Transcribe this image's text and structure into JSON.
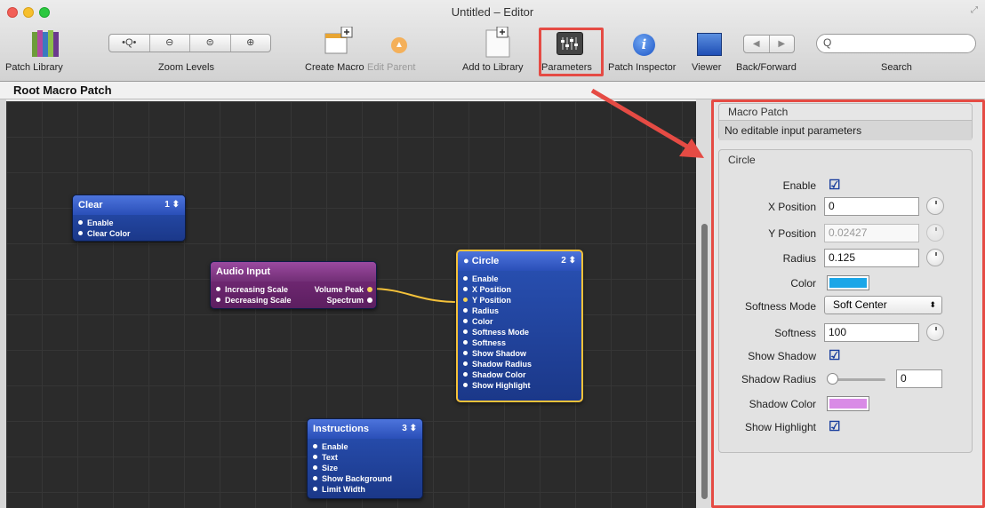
{
  "window": {
    "title": "Untitled – Editor"
  },
  "toolbar": {
    "patch_library": "Patch Library",
    "zoom_levels": "Zoom Levels",
    "create_macro": "Create Macro",
    "edit_parent": "Edit Parent",
    "add_to_library": "Add to Library",
    "parameters": "Parameters",
    "patch_inspector": "Patch Inspector",
    "viewer": "Viewer",
    "back_forward": "Back/Forward",
    "search": "Search",
    "search_placeholder": ""
  },
  "breadcrumb": "Root Macro Patch",
  "nodes": {
    "clear": {
      "title": "Clear",
      "badge": "1 ⬍",
      "ports": [
        "Enable",
        "Clear Color"
      ]
    },
    "audio": {
      "title": "Audio Input",
      "inputs": [
        "Increasing Scale",
        "Decreasing Scale"
      ],
      "outputs": [
        "Volume Peak",
        "Spectrum"
      ]
    },
    "circle": {
      "title": "Circle",
      "badge": "2 ⬍",
      "ports": [
        "Enable",
        "X Position",
        "Y Position",
        "Radius",
        "Color",
        "Softness Mode",
        "Softness",
        "Show Shadow",
        "Shadow Radius",
        "Shadow Color",
        "Show Highlight"
      ]
    },
    "instructions": {
      "title": "Instructions",
      "badge": "3 ⬍",
      "ports": [
        "Enable",
        "Text",
        "Size",
        "Show Background",
        "Limit Width"
      ]
    }
  },
  "panel": {
    "macro_header": "Macro Patch",
    "macro_message": "No editable input parameters",
    "circle_header": "Circle",
    "enable_label": "Enable",
    "x_label": "X Position",
    "x_value": "0",
    "y_label": "Y Position",
    "y_value": "0.02427",
    "radius_label": "Radius",
    "radius_value": "0.125",
    "color_label": "Color",
    "color_value": "#1aa6e8",
    "softness_mode_label": "Softness Mode",
    "softness_mode_value": "Soft Center",
    "softness_label": "Softness",
    "softness_value": "100",
    "show_shadow_label": "Show Shadow",
    "shadow_radius_label": "Shadow Radius",
    "shadow_radius_value": "0",
    "shadow_radius_level": 0,
    "shadow_color_label": "Shadow Color",
    "shadow_color_value": "#d98be6",
    "show_highlight_label": "Show Highlight",
    "enable_checked": true,
    "show_shadow_checked": true,
    "show_highlight_checked": true
  },
  "colors": {
    "annotation": "#e54b44",
    "node_blue": "#2a4fb8",
    "node_purple": "#722f76",
    "connection": "#f5c23a"
  }
}
